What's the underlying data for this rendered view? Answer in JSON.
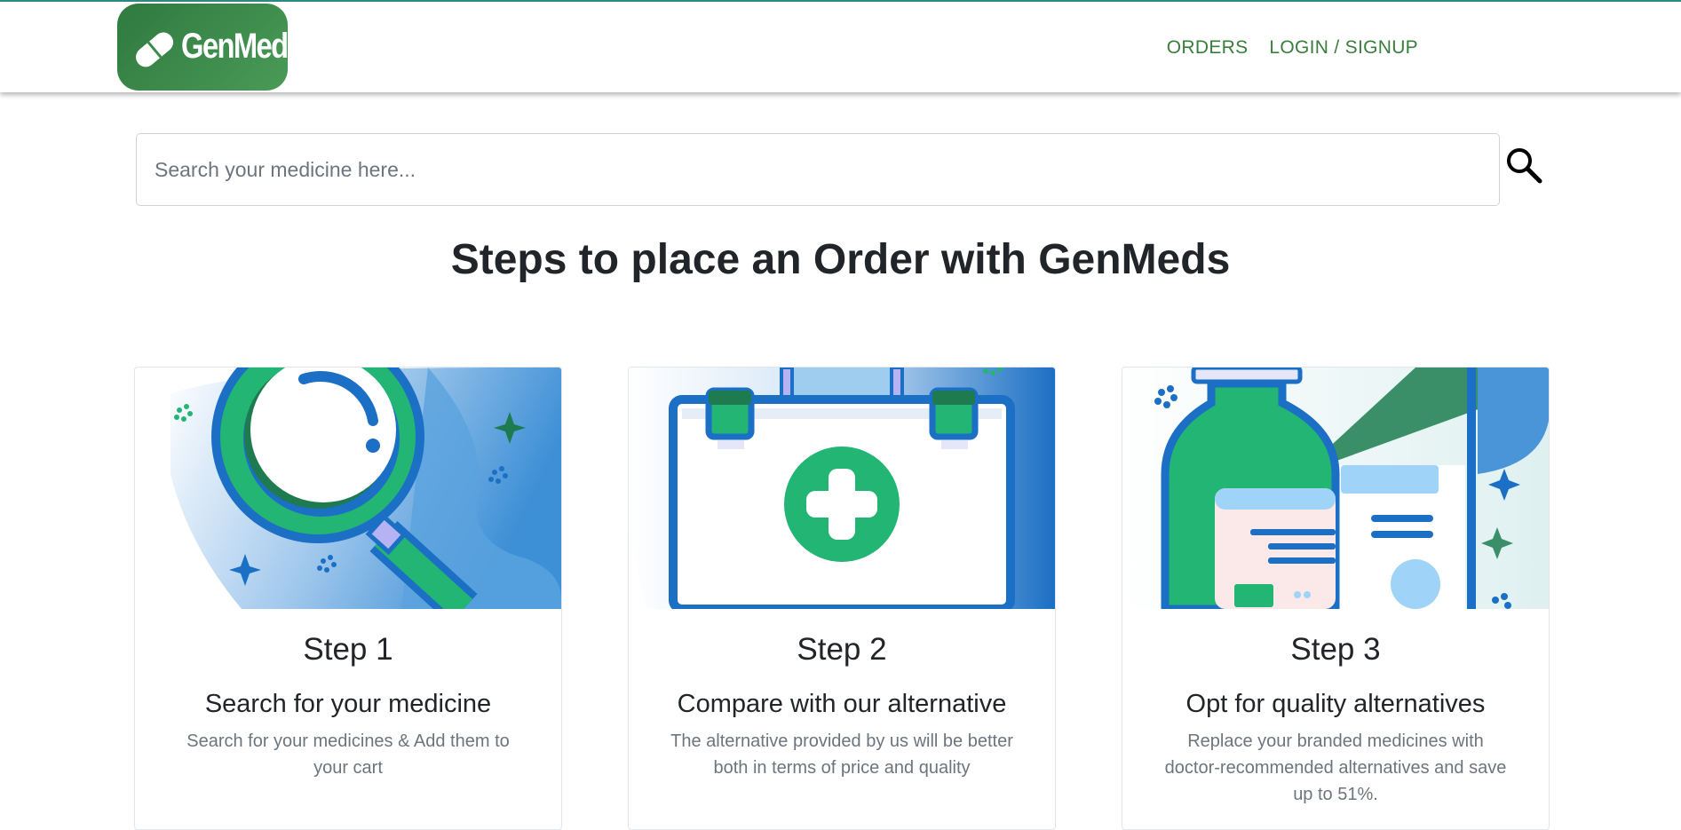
{
  "header": {
    "logo_text": "GenMed",
    "nav": {
      "orders": "ORDERS",
      "login": "LOGIN / SIGNUP"
    }
  },
  "search": {
    "placeholder": "Search your medicine here..."
  },
  "main": {
    "title": "Steps to place an Order with GenMeds",
    "steps": [
      {
        "title": "Step 1",
        "subtitle": "Search for your medicine",
        "description": "Search for your medicines & Add them to your cart"
      },
      {
        "title": "Step 2",
        "subtitle": "Compare with our alternative",
        "description": "The alternative provided by us will be better both in terms of price and quality"
      },
      {
        "title": "Step 3",
        "subtitle": "Opt for quality alternatives",
        "description": "Replace your branded medicines with doctor-recommended alternatives and save up to 51%."
      }
    ]
  },
  "colors": {
    "brand_green": "#3a7d3d",
    "illus_green": "#22b573",
    "illus_blue": "#1b6fc4",
    "topline": "#2e8b86"
  },
  "icons": [
    "pill-icon",
    "search-icon",
    "magnifier-illustration",
    "first-aid-kit-illustration",
    "medicine-bottle-illustration"
  ]
}
